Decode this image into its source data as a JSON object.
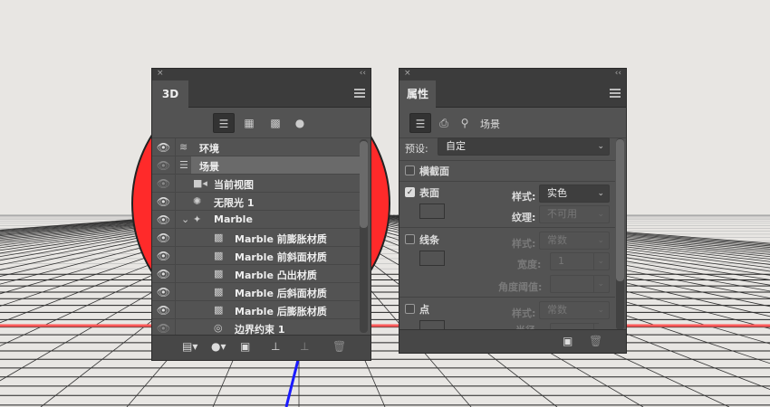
{
  "panel3d": {
    "close": "×",
    "collapse": "‹‹",
    "tab_label": "3D",
    "filter_icons": [
      "scene-filter-icon",
      "mesh-filter-icon",
      "material-filter-icon",
      "light-filter-icon"
    ],
    "layers": [
      {
        "label": "环境",
        "icon": "environment-icon",
        "visible": true,
        "indent": 0
      },
      {
        "label": "场景",
        "icon": "scene-icon",
        "visible": true,
        "indent": 0,
        "selected": true
      },
      {
        "label": "当前视图",
        "icon": "camera-icon",
        "visible": true,
        "indent": 1
      },
      {
        "label": "无限光 1",
        "icon": "light-icon",
        "visible": true,
        "indent": 1
      },
      {
        "label": "Marble",
        "icon": "mesh-icon",
        "visible": true,
        "indent": 1,
        "expanded": true
      },
      {
        "label": "Marble 前膨胀材质",
        "icon": "material-icon",
        "visible": true,
        "indent": 2
      },
      {
        "label": "Marble 前斜面材质",
        "icon": "material-icon",
        "visible": true,
        "indent": 2
      },
      {
        "label": "Marble 凸出材质",
        "icon": "material-icon",
        "visible": true,
        "indent": 2
      },
      {
        "label": "Marble 后斜面材质",
        "icon": "material-icon",
        "visible": true,
        "indent": 2
      },
      {
        "label": "Marble 后膨胀材质",
        "icon": "material-icon",
        "visible": true,
        "indent": 2
      },
      {
        "label": "边界约束 1",
        "icon": "constraint-icon",
        "visible": true,
        "indent": 2
      }
    ]
  },
  "properties": {
    "close": "×",
    "collapse": "‹‹",
    "tab_label": "属性",
    "section_label": "场景",
    "preset_label": "预设:",
    "preset_value": "自定",
    "cross_section": "横截面",
    "surface": {
      "label": "表面",
      "checked": true,
      "style_label": "样式:",
      "style_value": "实色",
      "texture_label": "纹理:",
      "texture_value": "不可用"
    },
    "lines": {
      "label": "线条",
      "checked": false,
      "style_label": "样式:",
      "style_value": "常数",
      "width_label": "宽度:",
      "width_value": "1",
      "angle_label": "角度阈值:"
    },
    "points": {
      "label": "点",
      "checked": false,
      "style_label": "样式:",
      "style_value": "常数",
      "radius_label": "半径"
    }
  }
}
